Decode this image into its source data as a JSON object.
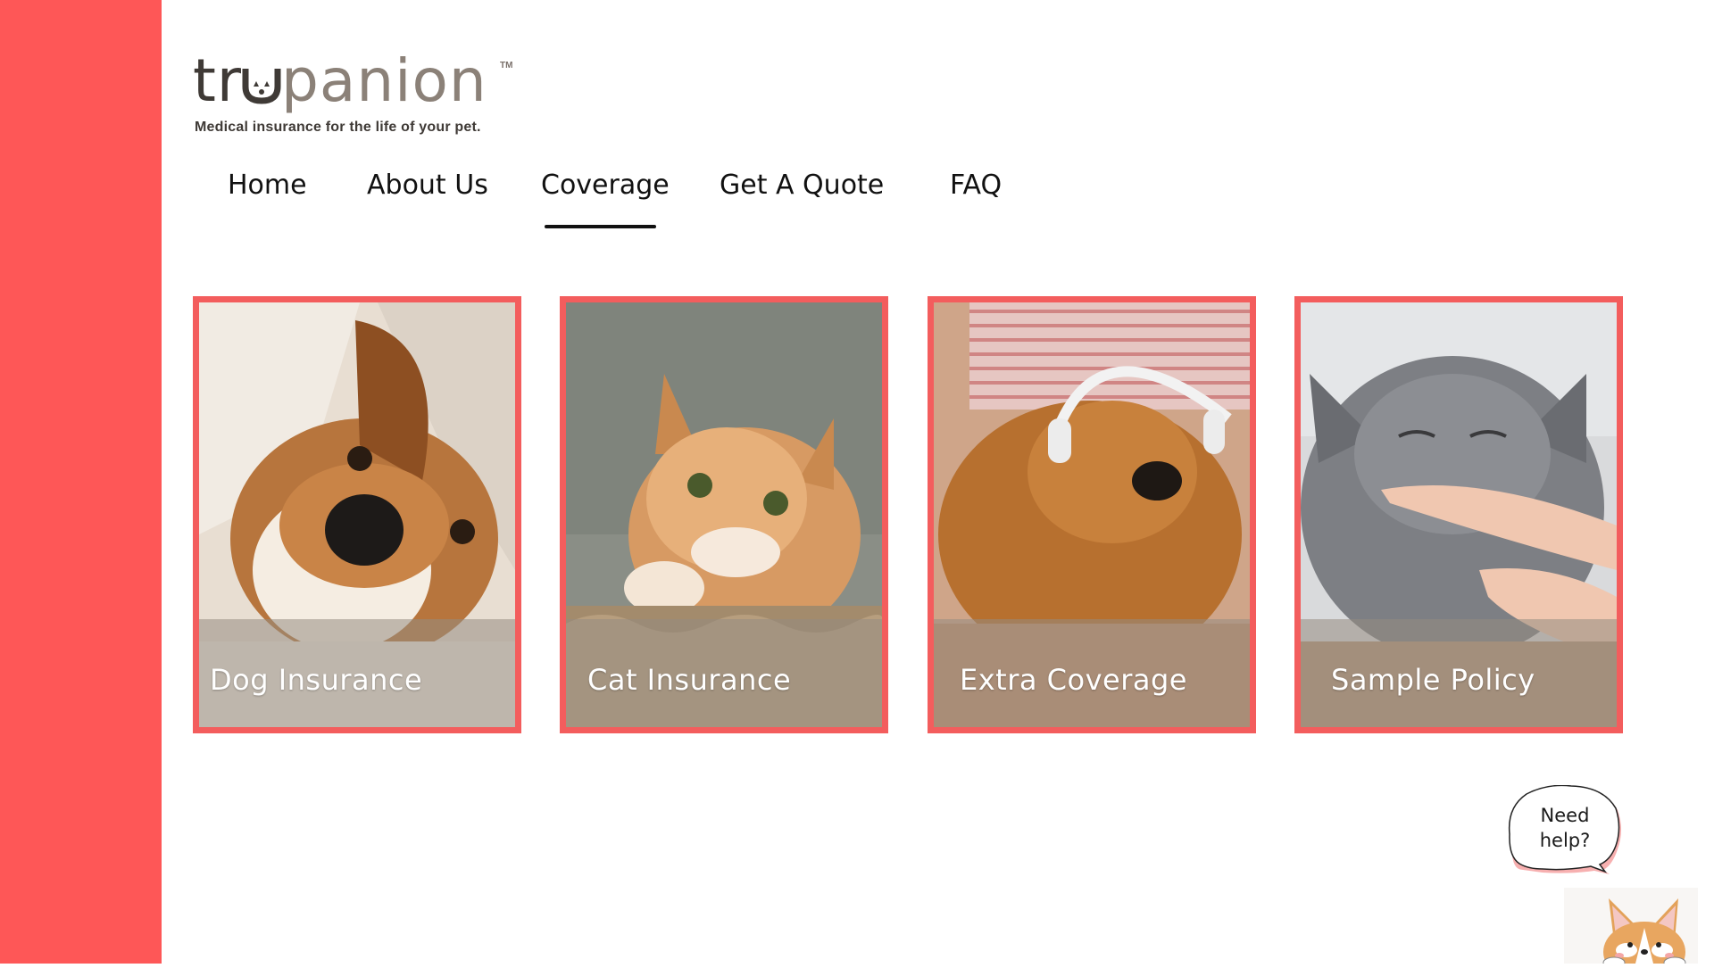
{
  "brand": {
    "name_part1": "tr",
    "name_part2": "panion",
    "trademark": "TM",
    "tagline": "Medical insurance for the life of your pet.",
    "primary_color": "#fe5757",
    "card_border_color": "#f35d5d"
  },
  "nav": {
    "items": [
      {
        "label": "Home"
      },
      {
        "label": "About Us"
      },
      {
        "label": "Coverage",
        "active": true
      },
      {
        "label": "Get A Quote"
      },
      {
        "label": "FAQ"
      }
    ]
  },
  "cards": [
    {
      "label": "Dog Insurance",
      "image": "dog-photo"
    },
    {
      "label": "Cat Insurance",
      "image": "cat-photo"
    },
    {
      "label": "Extra Coverage",
      "image": "dog-headphones-photo"
    },
    {
      "label": "Sample Policy",
      "image": "grey-cat-photo"
    }
  ],
  "help": {
    "line1": "Need",
    "line2": "help?",
    "mascot": "corgi-icon"
  }
}
